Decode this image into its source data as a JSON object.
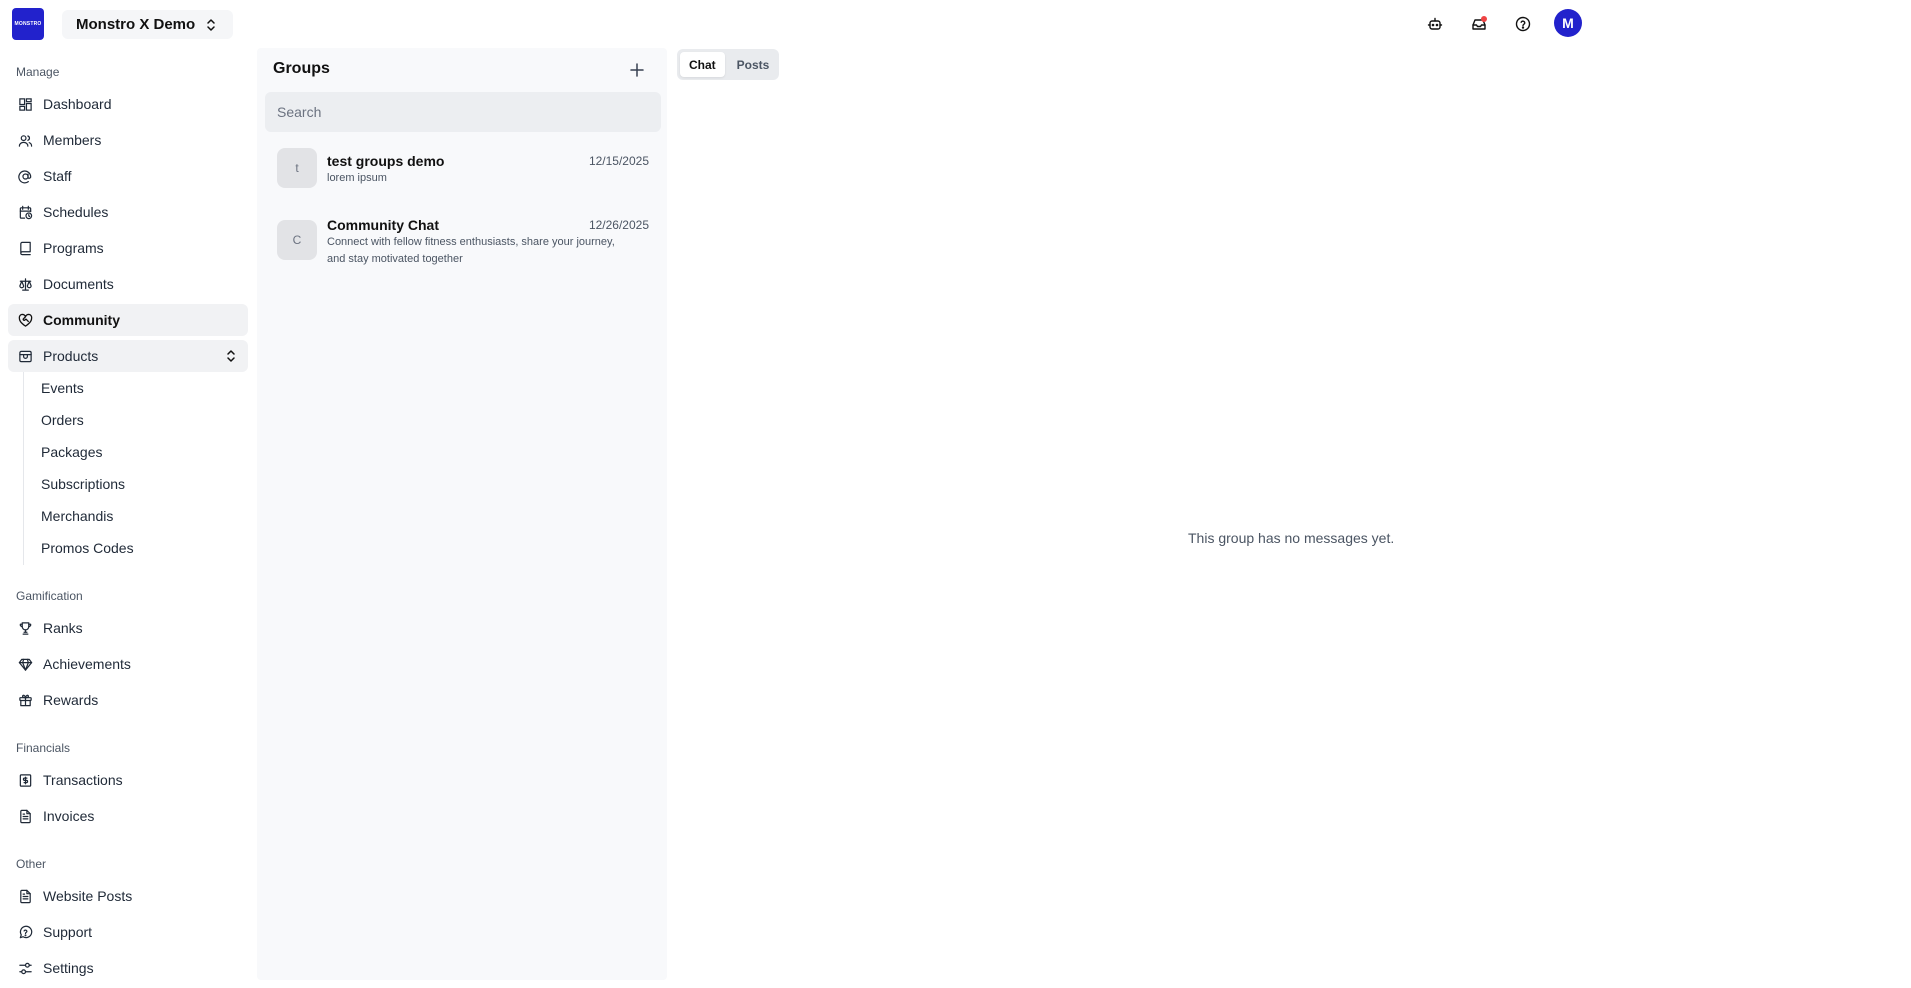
{
  "app": {
    "logo_text": "MONSTRO",
    "org_name": "Monstro X Demo",
    "avatar_initial": "M",
    "accent_color": "#2222cc"
  },
  "topbar": {
    "icons": [
      "bot-icon",
      "inbox-icon",
      "help-icon"
    ]
  },
  "sidebar": {
    "sections": {
      "manage": "Manage",
      "gamification": "Gamification",
      "financials": "Financials",
      "other": "Other"
    },
    "manage_items": {
      "dashboard": "Dashboard",
      "members": "Members",
      "staff": "Staff",
      "schedules": "Schedules",
      "programs": "Programs",
      "documents": "Documents",
      "community": "Community",
      "products": "Products"
    },
    "product_subitems": {
      "events": "Events",
      "orders": "Orders",
      "packages": "Packages",
      "subscriptions": "Subscriptions",
      "merchandis": "Merchandis",
      "promos": "Promos Codes"
    },
    "gamification_items": {
      "ranks": "Ranks",
      "achievements": "Achievements",
      "rewards": "Rewards"
    },
    "financial_items": {
      "transactions": "Transactions",
      "invoices": "Invoices"
    },
    "other_items": {
      "website_posts": "Website Posts",
      "support": "Support",
      "settings": "Settings"
    }
  },
  "groups": {
    "title": "Groups",
    "search_placeholder": "Search",
    "list": [
      {
        "initial": "t",
        "name": "test groups demo",
        "date": "12/15/2025",
        "description": "lorem ipsum"
      },
      {
        "initial": "C",
        "name": "Community Chat",
        "date": "12/26/2025",
        "description": "Connect with fellow fitness enthusiasts, share your journey, and stay motivated together"
      }
    ]
  },
  "chat": {
    "tabs": {
      "chat": "Chat",
      "posts": "Posts"
    },
    "empty_message": "This group has no messages yet."
  }
}
